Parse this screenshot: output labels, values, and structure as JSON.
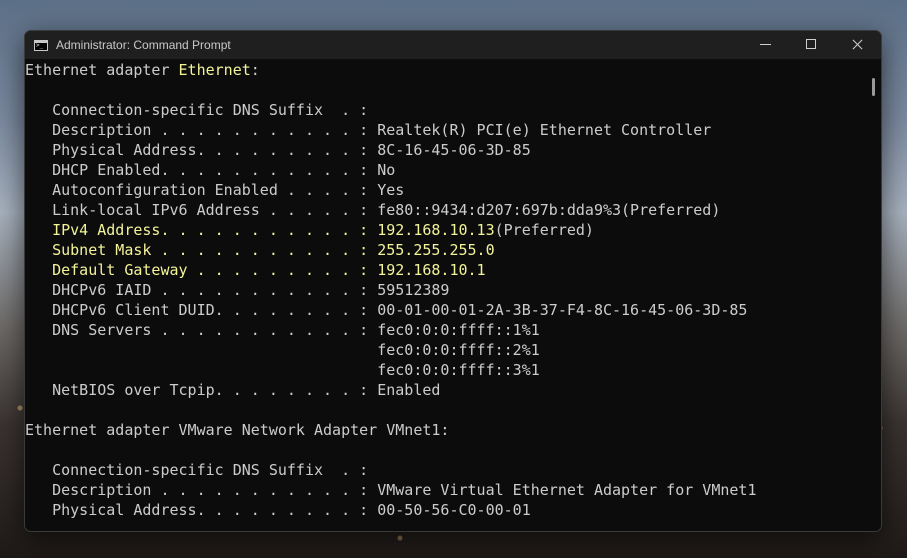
{
  "window": {
    "title": "Administrator: Command Prompt",
    "icon": "cmd-icon",
    "controls": [
      "minimize-icon",
      "maximize-icon",
      "close-icon"
    ]
  },
  "colors": {
    "console_bg": "#0c0c0c",
    "console_text": "#cccccc",
    "highlight_text": "#f3f39a",
    "titlebar_bg": "#1f1f1f"
  },
  "console": {
    "lines": [
      {
        "parts": [
          {
            "t": "Ethernet adapter ",
            "hl": false
          },
          {
            "t": "Ethernet",
            "hl": true
          },
          {
            "t": ":",
            "hl": false
          }
        ]
      },
      {
        "parts": [
          {
            "t": "",
            "hl": false
          }
        ]
      },
      {
        "parts": [
          {
            "t": "   Connection-specific DNS Suffix  . :",
            "hl": false
          }
        ]
      },
      {
        "parts": [
          {
            "t": "   Description . . . . . . . . . . . : Realtek(R) PCI(e) Ethernet Controller",
            "hl": false
          }
        ]
      },
      {
        "parts": [
          {
            "t": "   Physical Address. . . . . . . . . : 8C-16-45-06-3D-85",
            "hl": false
          }
        ]
      },
      {
        "parts": [
          {
            "t": "   DHCP Enabled. . . . . . . . . . . : No",
            "hl": false
          }
        ]
      },
      {
        "parts": [
          {
            "t": "   Autoconfiguration Enabled . . . . : Yes",
            "hl": false
          }
        ]
      },
      {
        "parts": [
          {
            "t": "   Link-local IPv6 Address . . . . . : fe80::9434:d207:697b:dda9%3(Preferred)",
            "hl": false
          }
        ]
      },
      {
        "parts": [
          {
            "t": "   ",
            "hl": false
          },
          {
            "t": "IPv4 Address. . . . . . . . . . . : 192.168.10.13",
            "hl": true
          },
          {
            "t": "(Preferred)",
            "hl": false
          }
        ]
      },
      {
        "parts": [
          {
            "t": "   ",
            "hl": false
          },
          {
            "t": "Subnet Mask . . . . . . . . . . . : 255.255.255.0",
            "hl": true
          }
        ]
      },
      {
        "parts": [
          {
            "t": "   ",
            "hl": false
          },
          {
            "t": "Default Gateway . . . . . . . . . : 192.168.10.1",
            "hl": true
          }
        ]
      },
      {
        "parts": [
          {
            "t": "   DHCPv6 IAID . . . . . . . . . . . : 59512389",
            "hl": false
          }
        ]
      },
      {
        "parts": [
          {
            "t": "   DHCPv6 Client DUID. . . . . . . . : 00-01-00-01-2A-3B-37-F4-8C-16-45-06-3D-85",
            "hl": false
          }
        ]
      },
      {
        "parts": [
          {
            "t": "   DNS Servers . . . . . . . . . . . : fec0:0:0:ffff::1%1",
            "hl": false
          }
        ]
      },
      {
        "parts": [
          {
            "t": "                                       fec0:0:0:ffff::2%1",
            "hl": false
          }
        ]
      },
      {
        "parts": [
          {
            "t": "                                       fec0:0:0:ffff::3%1",
            "hl": false
          }
        ]
      },
      {
        "parts": [
          {
            "t": "   NetBIOS over Tcpip. . . . . . . . : Enabled",
            "hl": false
          }
        ]
      },
      {
        "parts": [
          {
            "t": "",
            "hl": false
          }
        ]
      },
      {
        "parts": [
          {
            "t": "Ethernet adapter VMware Network Adapter VMnet1:",
            "hl": false
          }
        ]
      },
      {
        "parts": [
          {
            "t": "",
            "hl": false
          }
        ]
      },
      {
        "parts": [
          {
            "t": "   Connection-specific DNS Suffix  . :",
            "hl": false
          }
        ]
      },
      {
        "parts": [
          {
            "t": "   Description . . . . . . . . . . . : VMware Virtual Ethernet Adapter for VMnet1",
            "hl": false
          }
        ]
      },
      {
        "parts": [
          {
            "t": "   Physical Address. . . . . . . . . : 00-50-56-C0-00-01",
            "hl": false
          }
        ]
      }
    ]
  }
}
